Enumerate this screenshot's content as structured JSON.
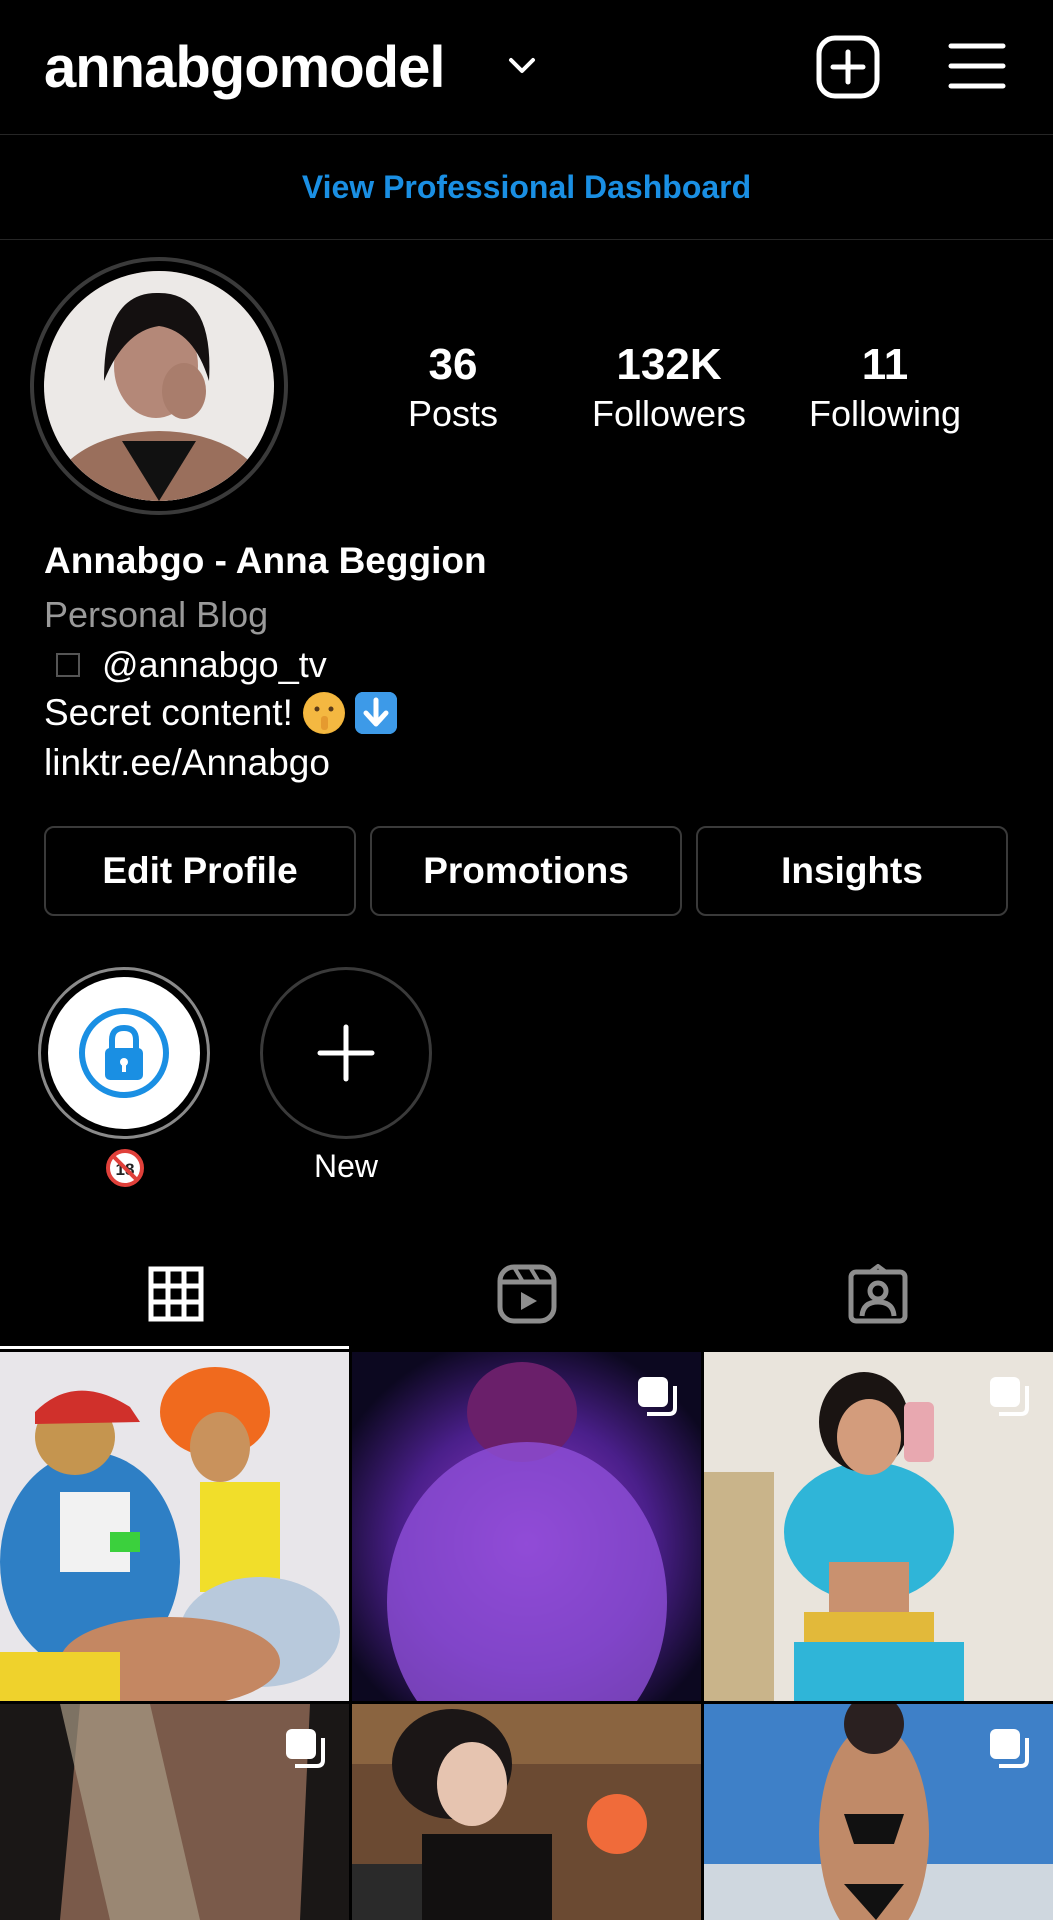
{
  "header": {
    "username": "annabgomodel"
  },
  "dashboard_link": "View Professional Dashboard",
  "stats": [
    {
      "value": "36",
      "label": "Posts"
    },
    {
      "value": "132K",
      "label": "Followers"
    },
    {
      "value": "11",
      "label": "Following"
    }
  ],
  "bio": {
    "name": "Annabgo - Anna Beggion",
    "category": "Personal Blog",
    "handle": "@annabgo_tv",
    "text": "Secret content!",
    "link": "linktr.ee/Annabgo"
  },
  "actions": {
    "edit": "Edit Profile",
    "promotions": "Promotions",
    "insights": "Insights"
  },
  "highlights": {
    "new_label": "New",
    "first_icon": "lock-icon",
    "first_label_icon": "no-under-18-icon"
  },
  "tabs": [
    "grid-icon",
    "reels-icon",
    "tagged-icon"
  ],
  "colors": {
    "accent": "#1a8fe3",
    "background": "#000000",
    "divider": "#262626"
  }
}
